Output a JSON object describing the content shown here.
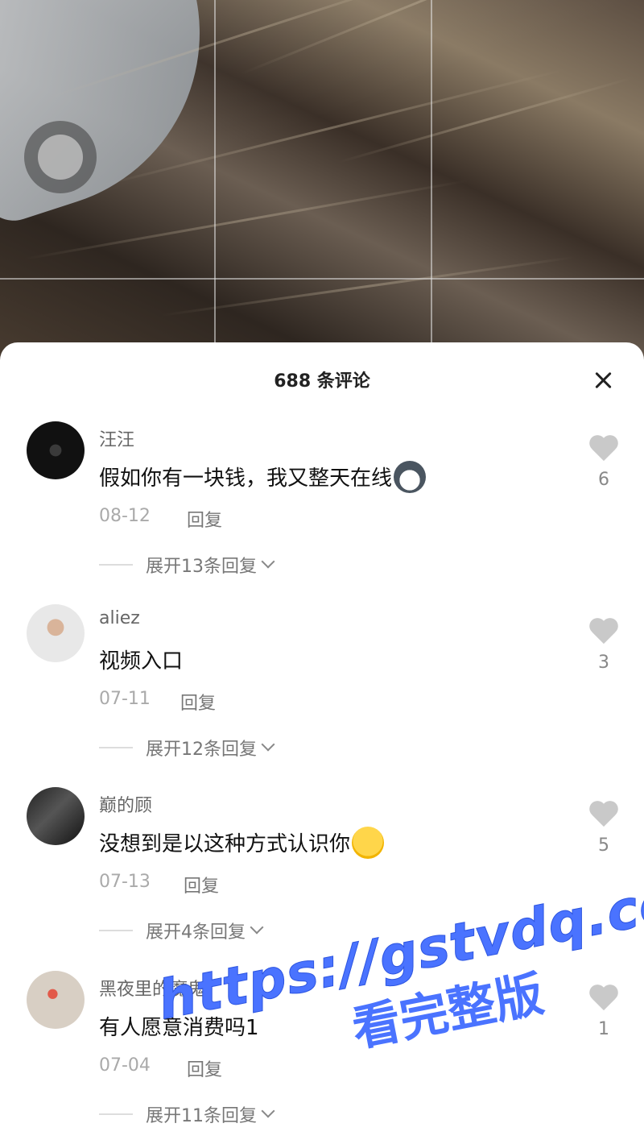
{
  "sheet": {
    "title": "688 条评论"
  },
  "comments": [
    {
      "username": "汪汪",
      "text": "假如你有一块钱，我又整天在线",
      "date": "08-12",
      "reply_label": "回复",
      "expand_label": "展开13条回复",
      "likes": "6",
      "emoji": "husky-emoji"
    },
    {
      "username": "aliez",
      "text": "视频入口",
      "date": "07-11",
      "reply_label": "回复",
      "expand_label": "展开12条回复",
      "likes": "3"
    },
    {
      "username": "巅的顾",
      "text": "没想到是以这种方式认识你",
      "date": "07-13",
      "reply_label": "回复",
      "expand_label": "展开4条回复",
      "likes": "5",
      "emoji": "laughing-emoji"
    },
    {
      "username": "黑夜里的魔鬼",
      "text": "有人愿意消费吗1",
      "date": "07-04",
      "reply_label": "回复",
      "expand_label": "展开11条回复",
      "likes": "1"
    }
  ],
  "watermark": {
    "line1": "https://gstvdq.com",
    "line2": "看完整版"
  },
  "colors": {
    "watermark": "#4a73ff",
    "like_heart": "#c9c9c9",
    "sheet_bg": "#ffffff"
  }
}
